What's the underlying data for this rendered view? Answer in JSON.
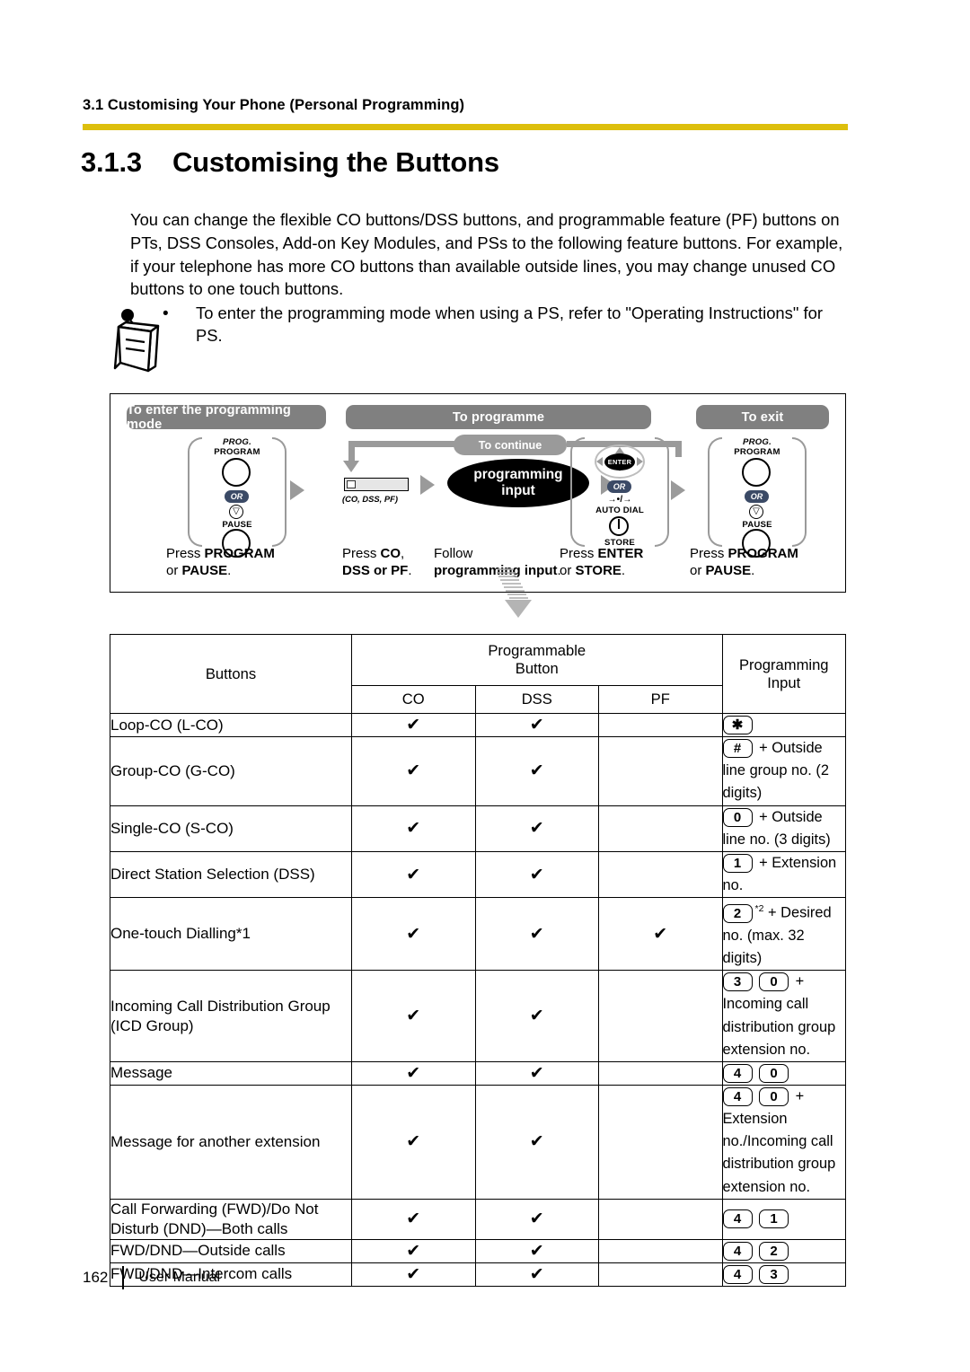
{
  "header": {
    "section": "3.1 Customising Your Phone (Personal Programming)",
    "rule_color": "#ddbf0d"
  },
  "title": {
    "number": "3.1.3",
    "text": "Customising the Buttons"
  },
  "intro": "You can change the flexible CO buttons/DSS buttons, and programmable feature (PF) buttons on PTs, DSS Consoles, Add-on Key Modules, and PSs to the following feature buttons. For example, if your telephone has more CO buttons than available outside lines, you may change unused CO buttons to one touch buttons.",
  "note": {
    "bullet": "•",
    "text": "To enter the programming mode when using a PS, refer to \"Operating Instructions\" for PS."
  },
  "flow": {
    "pills": {
      "enter_mode": "To enter the programming mode",
      "to_programme": "To programme",
      "to_exit": "To exit",
      "to_continue": "To continue"
    },
    "step1": {
      "key_top_small": "PROG.",
      "key_top": "PROGRAM",
      "or": "OR",
      "key_bottom": "PAUSE",
      "caption_line1_pre": "Press ",
      "caption_line1_bold": "PROGRAM",
      "caption_line2_pre": "or ",
      "caption_line2_bold": "PAUSE",
      "caption_line2_post": "."
    },
    "step2": {
      "flat_key_caption": "(CO, DSS, PF)",
      "caption_line1_pre": "Press ",
      "caption_line1_bold": "CO",
      "caption_line1_post": ",",
      "caption_line2_bold": "DSS or PF",
      "caption_line2_post": "."
    },
    "step3": {
      "ellipse_line1": "programming",
      "ellipse_line2": "input",
      "caption_line1": "Follow",
      "caption_line2_bold": "programming input",
      "caption_line2_post": "."
    },
    "step4": {
      "enter": "ENTER",
      "or": "OR",
      "auto_dial_sym": "→•/→",
      "auto_dial": "AUTO DIAL",
      "store": "STORE",
      "caption_line1_pre": "Press ",
      "caption_line1_bold": "ENTER",
      "caption_line2_pre": "or ",
      "caption_line2_bold": "STORE",
      "caption_line2_post": "."
    },
    "step5": {
      "key_top_small": "PROG.",
      "key_top": "PROGRAM",
      "or": "OR",
      "key_bottom": "PAUSE",
      "caption_line1_pre": "Press ",
      "caption_line1_bold": "PROGRAM",
      "caption_line2_pre": "or ",
      "caption_line2_bold": "PAUSE",
      "caption_line2_post": "."
    }
  },
  "table": {
    "headers": {
      "buttons": "Buttons",
      "programmable_button_l1": "Programmable",
      "programmable_button_l2": "Button",
      "co": "CO",
      "dss": "DSS",
      "pf": "PF",
      "programming_input": "Programming Input"
    },
    "check": "✔",
    "rows": [
      {
        "name": "Loop-CO (L-CO)",
        "co": true,
        "dss": true,
        "pf": false,
        "keys": [
          "✱"
        ],
        "sup": "",
        "text": ""
      },
      {
        "name": "Group-CO (G-CO)",
        "co": true,
        "dss": true,
        "pf": false,
        "keys": [
          "#"
        ],
        "sup": "",
        "text": "+ Outside line group no. (2 digits)"
      },
      {
        "name": "Single-CO (S-CO)",
        "co": true,
        "dss": true,
        "pf": false,
        "keys": [
          "0"
        ],
        "sup": "",
        "text": "+ Outside line no. (3 digits)"
      },
      {
        "name": "Direct Station Selection (DSS)",
        "co": true,
        "dss": true,
        "pf": false,
        "keys": [
          "1"
        ],
        "sup": "",
        "text": "+ Extension no."
      },
      {
        "name": "One-touch Dialling*1",
        "co": true,
        "dss": true,
        "pf": true,
        "keys": [
          "2"
        ],
        "sup": "*2",
        "text": "+ Desired no. (max. 32 digits)"
      },
      {
        "name": "Incoming Call Distribution Group (ICD Group)",
        "co": true,
        "dss": true,
        "pf": false,
        "keys": [
          "3",
          "0"
        ],
        "sup": "",
        "text": "+ Incoming call distribution group extension no."
      },
      {
        "name": "Message",
        "co": true,
        "dss": true,
        "pf": false,
        "keys": [
          "4",
          "0"
        ],
        "sup": "",
        "text": ""
      },
      {
        "name": "Message for another extension",
        "co": true,
        "dss": true,
        "pf": false,
        "keys": [
          "4",
          "0"
        ],
        "sup": "",
        "text": "+ Extension no./Incoming call distribution group extension no."
      },
      {
        "name": "Call Forwarding (FWD)/Do Not Disturb (DND)—Both calls",
        "co": true,
        "dss": true,
        "pf": false,
        "keys": [
          "4",
          "1"
        ],
        "sup": "",
        "text": ""
      },
      {
        "name": "FWD/DND—Outside calls",
        "co": true,
        "dss": true,
        "pf": false,
        "keys": [
          "4",
          "2"
        ],
        "sup": "",
        "text": ""
      },
      {
        "name": "FWD/DND—Intercom calls",
        "co": true,
        "dss": true,
        "pf": false,
        "keys": [
          "4",
          "3"
        ],
        "sup": "",
        "text": ""
      }
    ]
  },
  "footer": {
    "page": "162",
    "label": "User Manual"
  }
}
